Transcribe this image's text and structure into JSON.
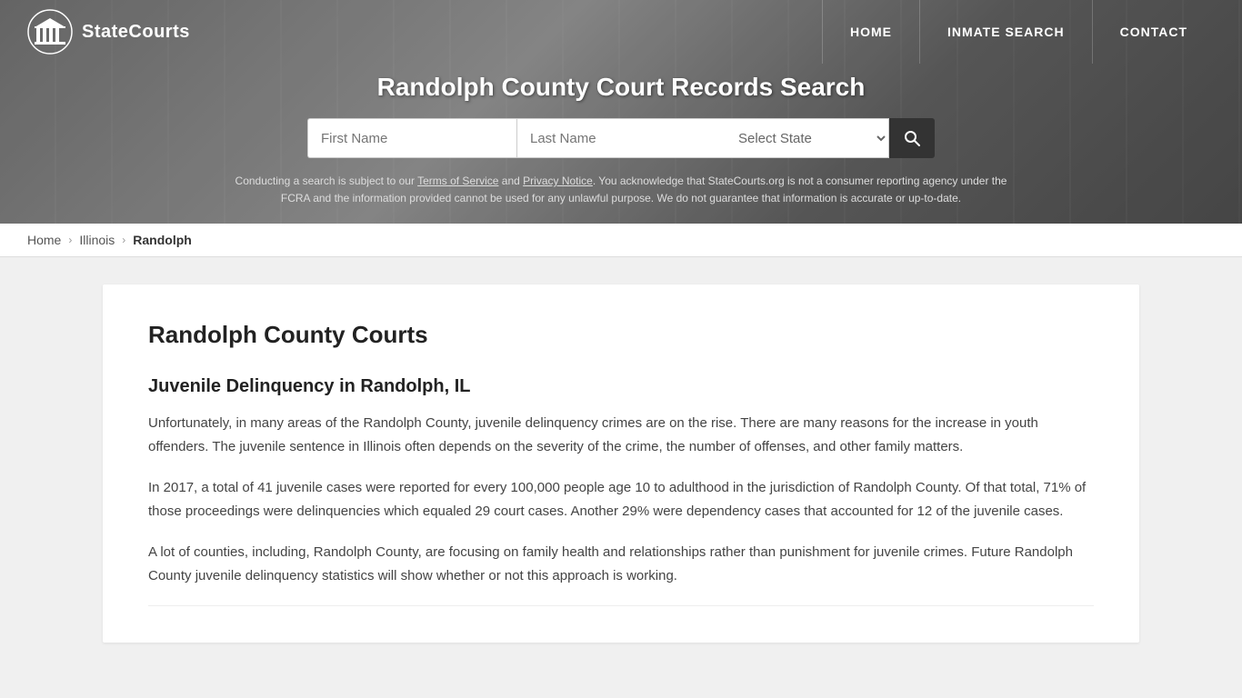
{
  "site": {
    "logo_text": "StateCourts",
    "logo_icon_alt": "courthouse-columns-icon"
  },
  "nav": {
    "home_label": "HOME",
    "inmate_search_label": "INMATE SEARCH",
    "contact_label": "CONTACT"
  },
  "header": {
    "page_title": "Randolph County Court Records Search",
    "search": {
      "first_name_placeholder": "First Name",
      "last_name_placeholder": "Last Name",
      "state_placeholder": "Select State",
      "search_button_label": "Search"
    },
    "disclaimer": "Conducting a search is subject to our Terms of Service and Privacy Notice. You acknowledge that StateCourts.org is not a consumer reporting agency under the FCRA and the information provided cannot be used for any unlawful purpose. We do not guarantee that information is accurate or up-to-date.",
    "terms_label": "Terms of Service",
    "privacy_label": "Privacy Notice"
  },
  "breadcrumb": {
    "home_label": "Home",
    "state_label": "Illinois",
    "county_label": "Randolph"
  },
  "content": {
    "main_heading": "Randolph County Courts",
    "section1": {
      "heading": "Juvenile Delinquency in Randolph, IL",
      "para1": "Unfortunately, in many areas of the Randolph County, juvenile delinquency crimes are on the rise. There are many reasons for the increase in youth offenders. The juvenile sentence in Illinois often depends on the severity of the crime, the number of offenses, and other family matters.",
      "para2": "In 2017, a total of 41 juvenile cases were reported for every 100,000 people age 10 to adulthood in the jurisdiction of Randolph County. Of that total, 71% of those proceedings were delinquencies which equaled 29 court cases. Another 29% were dependency cases that accounted for 12 of the juvenile cases.",
      "para3": "A lot of counties, including, Randolph County, are focusing on family health and relationships rather than punishment for juvenile crimes. Future Randolph County juvenile delinquency statistics will show whether or not this approach is working."
    }
  }
}
